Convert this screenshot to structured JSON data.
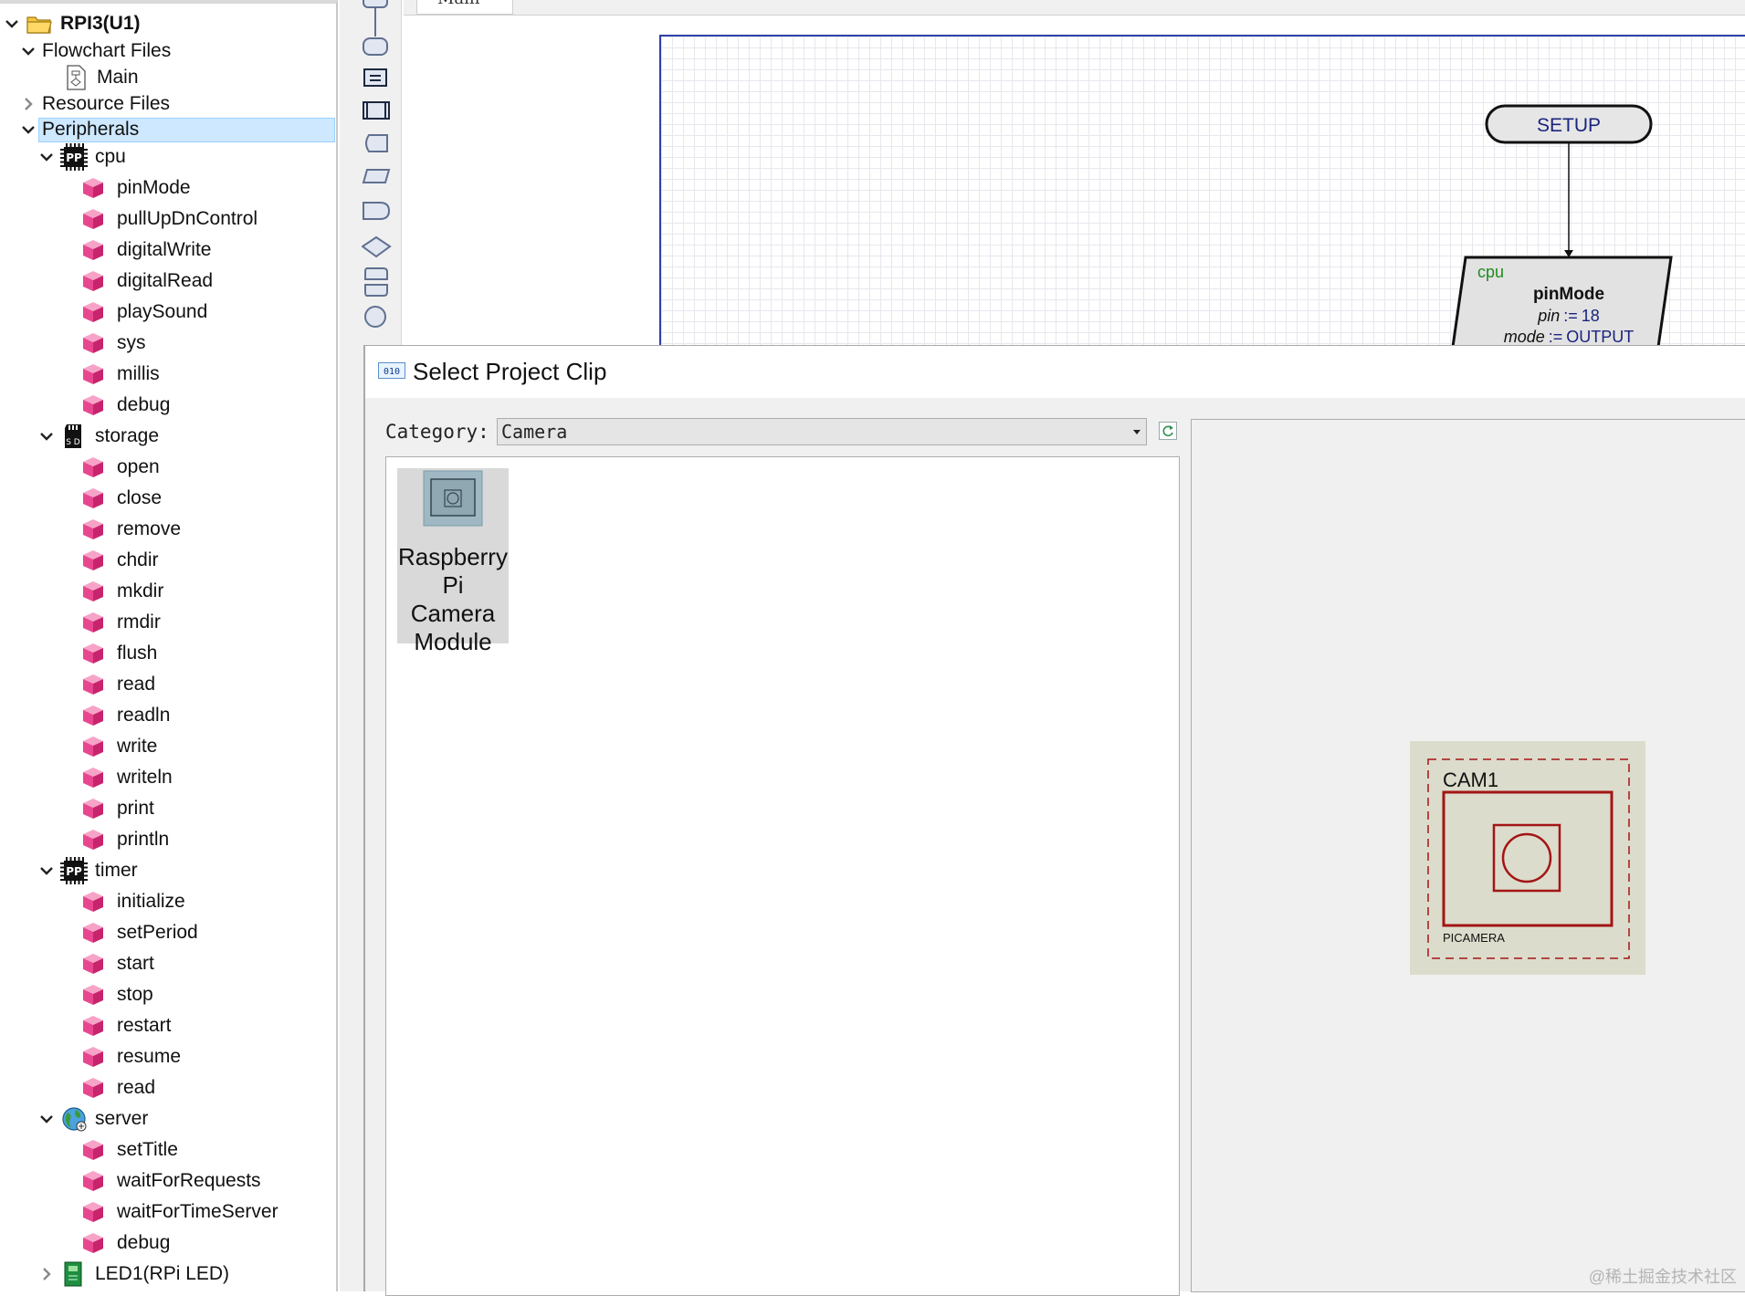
{
  "tree": {
    "root": "RPI3(U1)",
    "flowchart_files": "Flowchart Files",
    "main": "Main",
    "resource_files": "Resource Files",
    "peripherals": "Peripherals",
    "cpu": {
      "label": "cpu",
      "items": [
        "pinMode",
        "pullUpDnControl",
        "digitalWrite",
        "digitalRead",
        "playSound",
        "sys",
        "millis",
        "debug"
      ]
    },
    "storage": {
      "label": "storage",
      "items": [
        "open",
        "close",
        "remove",
        "chdir",
        "mkdir",
        "rmdir",
        "flush",
        "read",
        "readln",
        "write",
        "writeln",
        "print",
        "println"
      ]
    },
    "timer": {
      "label": "timer",
      "items": [
        "initialize",
        "setPeriod",
        "start",
        "stop",
        "restart",
        "resume",
        "read"
      ]
    },
    "server": {
      "label": "server",
      "items": [
        "setTitle",
        "waitForRequests",
        "waitForTimeServer",
        "debug"
      ]
    },
    "led": "LED1(RPi LED)"
  },
  "editor": {
    "tab": "Main",
    "setup": "SETUP",
    "block": {
      "device": "cpu",
      "method": "pinMode",
      "arg1_name": "pin",
      "arg1_op": ":=",
      "arg1_value": "18",
      "arg2_name": "mode",
      "arg2_op": ":=",
      "arg2_value": "OUTPUT"
    }
  },
  "dialog": {
    "icon_text": "010",
    "title": "Select Project Clip",
    "category_label": "Category:",
    "category_value": "Camera",
    "clip_name": "Raspberry Pi Camera Module",
    "preview_ref": "CAM1",
    "preview_part": "PICAMERA"
  },
  "watermark": "@稀土掘金技术社区",
  "colors": {
    "selection": "#cde8ff",
    "cube": "#e8478f",
    "canvas_border": "#2f3fa8",
    "setup_text": "#1a237e",
    "device_text": "#1e8b1e",
    "camera_red": "#a31515"
  }
}
